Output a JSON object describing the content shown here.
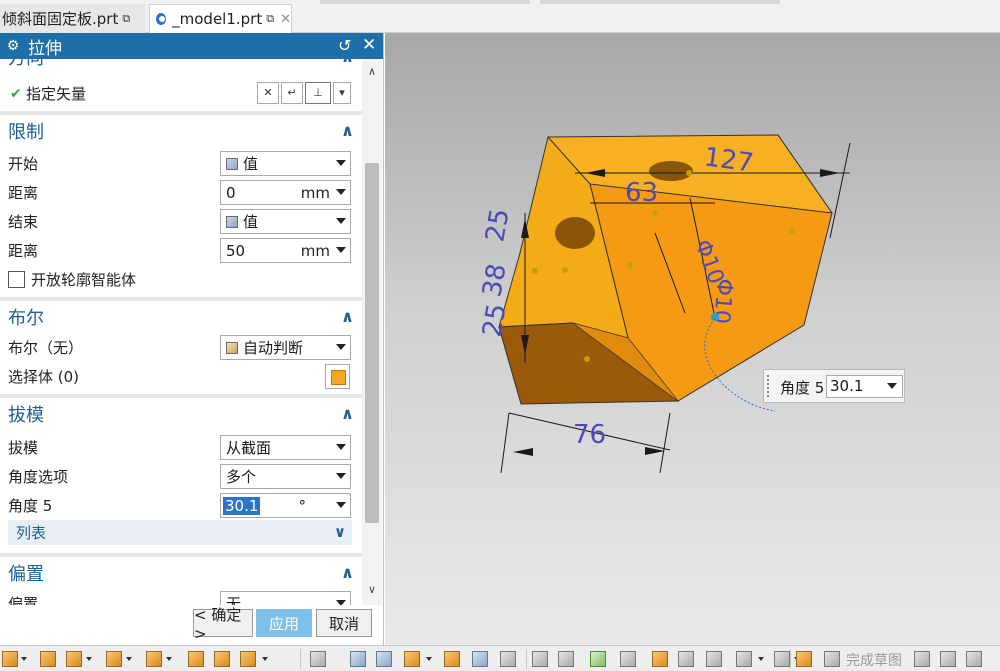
{
  "tabs": [
    {
      "label": "倾斜面固定板.prt",
      "active": false
    },
    {
      "label": "_model1.prt",
      "active": true
    }
  ],
  "dialog": {
    "title": "拉伸",
    "partial_section_label": "方向",
    "vector": {
      "label": "指定矢量"
    },
    "limits": {
      "header": "限制",
      "start_label": "开始",
      "start_value": "值",
      "start_dist_label": "距离",
      "start_dist_value": "0",
      "start_dist_unit": "mm",
      "end_label": "结束",
      "end_value": "值",
      "end_dist_label": "距离",
      "end_dist_value": "50",
      "end_dist_unit": "mm",
      "open_profile_label": "开放轮廓智能体"
    },
    "boolean": {
      "header": "布尔",
      "bool_label": "布尔（无）",
      "bool_value": "自动判断",
      "select_body_label": "选择体 (0)"
    },
    "draft": {
      "header": "拔模",
      "draft_label": "拔模",
      "draft_value": "从截面",
      "angle_option_label": "角度选项",
      "angle_option_value": "多个",
      "angle_label": "角度 5",
      "angle_value": "30.1",
      "angle_unit": "°",
      "list_label": "列表"
    },
    "offset": {
      "header": "偏置",
      "partial_label": "偏置",
      "partial_value": "无"
    },
    "buttons": {
      "ok": "< 确定 >",
      "apply": "应用",
      "cancel": "取消"
    }
  },
  "viewport": {
    "dimensions": [
      "127",
      "63",
      "25",
      "38",
      "25",
      "76",
      "Φ10",
      "Φ10"
    ],
    "angle_input": {
      "label": "角度 5",
      "value": "30.1"
    }
  },
  "toolbar": {
    "finish_sketch": "完成草图"
  },
  "colors": {
    "title_bar": "#1e6fa8",
    "accent": "#1f5f95",
    "apply_button": "#7ec0e8",
    "part_orange": "#f5a623"
  }
}
